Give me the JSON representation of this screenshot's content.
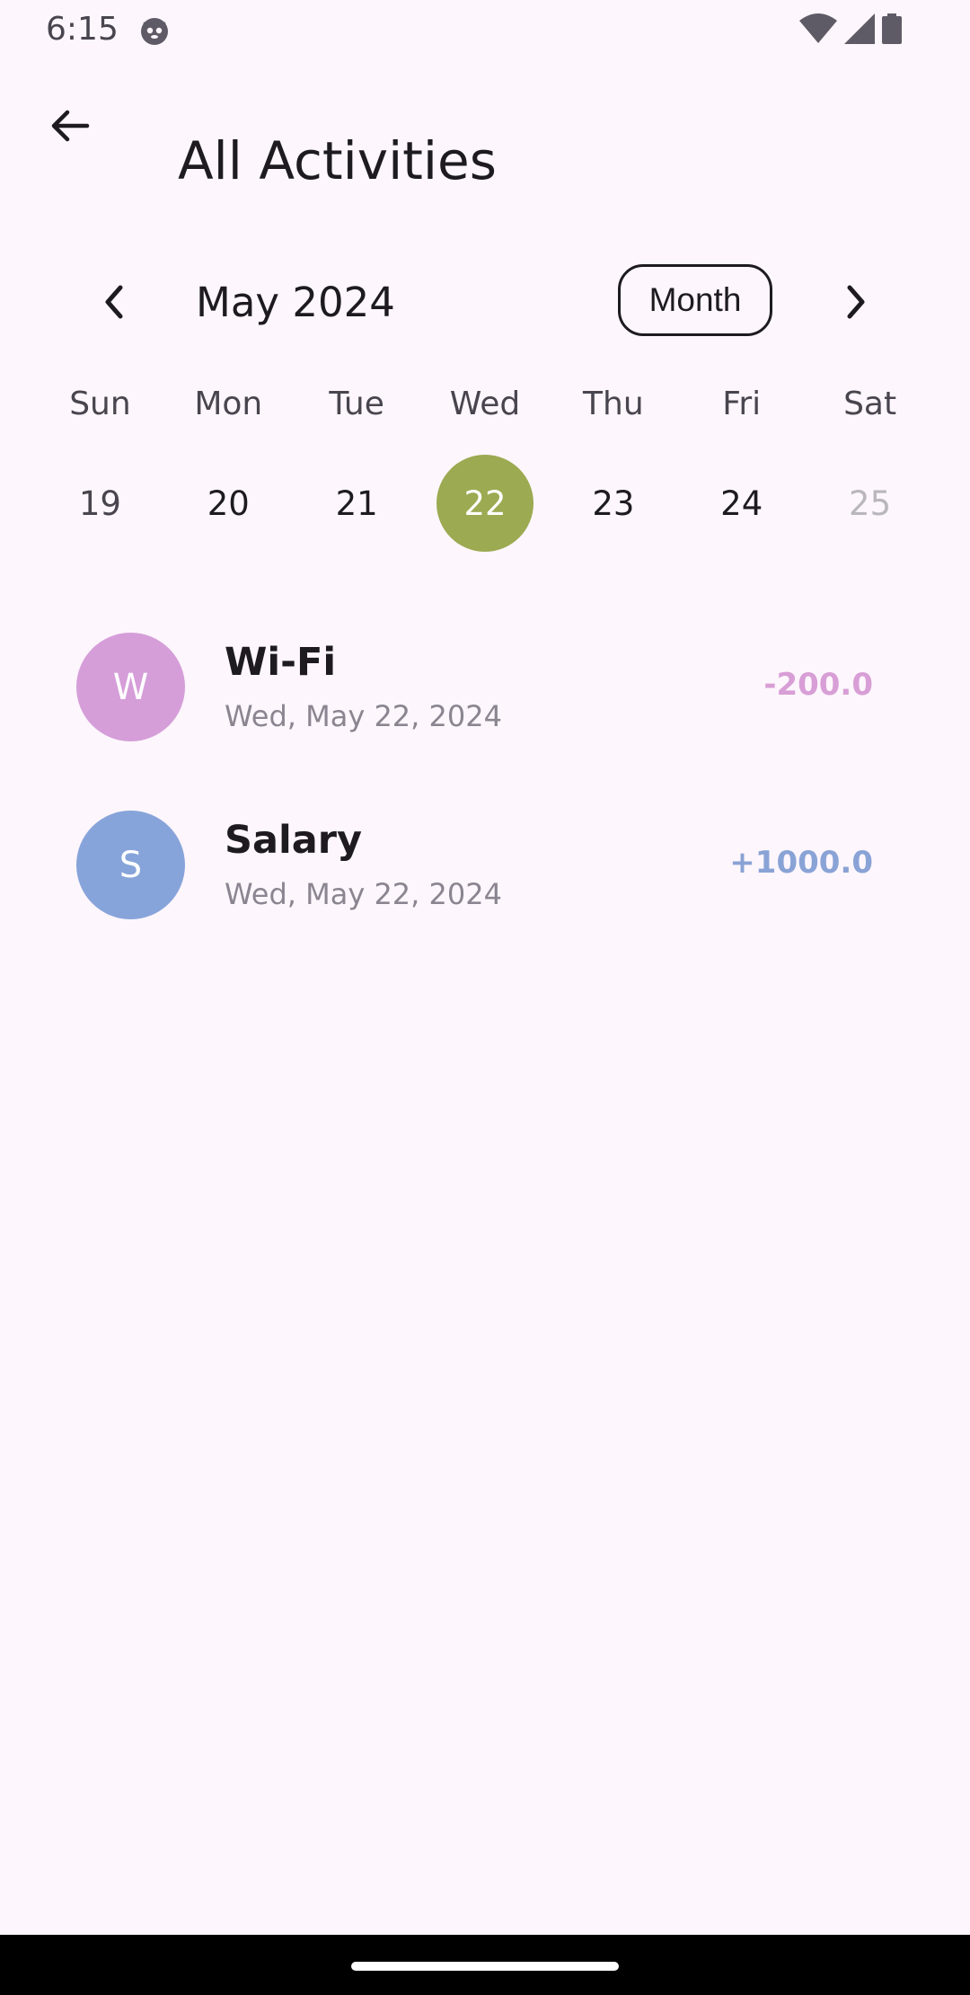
{
  "status_bar": {
    "time": "6:15"
  },
  "app_bar": {
    "title": "All Activities",
    "back_icon": "arrow-back-icon"
  },
  "calendar": {
    "month_label": "May 2024",
    "format_button": "Month",
    "days": [
      {
        "dow": "Sun",
        "num": "19",
        "state": "muted"
      },
      {
        "dow": "Mon",
        "num": "20",
        "state": "normal"
      },
      {
        "dow": "Tue",
        "num": "21",
        "state": "normal"
      },
      {
        "dow": "Wed",
        "num": "22",
        "state": "selected"
      },
      {
        "dow": "Thu",
        "num": "23",
        "state": "normal"
      },
      {
        "dow": "Fri",
        "num": "24",
        "state": "normal"
      },
      {
        "dow": "Sat",
        "num": "25",
        "state": "outside"
      }
    ],
    "selected_color": "#9caa52"
  },
  "transactions": [
    {
      "initial": "W",
      "name": "Wi-Fi",
      "date": "Wed, May 22, 2024",
      "amount": "-200.0",
      "avatar_color": "#d59ed9",
      "amount_color": "#d89ed6"
    },
    {
      "initial": "S",
      "name": "Salary",
      "date": "Wed, May 22, 2024",
      "amount": "+1000.0",
      "avatar_color": "#87a4da",
      "amount_color": "#8aa3d6"
    }
  ]
}
